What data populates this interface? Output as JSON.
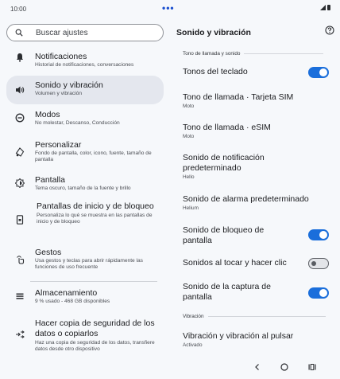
{
  "status": {
    "time": "10:00",
    "dots": "•••"
  },
  "search": {
    "placeholder": "Buscar ajustes"
  },
  "menu": [
    {
      "title": "Notificaciones",
      "sub": "Historial de notificaciones, conversaciones",
      "icon": "bell-icon"
    },
    {
      "title": "Sonido y vibración",
      "sub": "Volumen y vibración",
      "icon": "volume-icon"
    },
    {
      "title": "Modos",
      "sub": "No molestar, Descanso, Conducción",
      "icon": "do-not-disturb-icon"
    },
    {
      "title": "Personalizar",
      "sub": "Fondo de pantalla, color, icono, fuente, tamaño de pantalla",
      "icon": "palette-icon"
    },
    {
      "title": "Pantalla",
      "sub": "Tema oscuro, tamaño de la fuente y brillo",
      "icon": "display-brightness-icon"
    },
    {
      "title": "Pantallas de inicio y de bloqueo",
      "sub": "Personaliza lo qué se muestra en las pantallas de inicio y de bloqueo",
      "icon": "lock-screen-icon"
    },
    {
      "title": "Gestos",
      "sub": "Usa gestos y teclas para abrir rápidamente las funciones de uso frecuente",
      "icon": "gesture-icon"
    },
    {
      "title": "Almacenamiento",
      "sub": "9 % usado - 468 GB disponibles",
      "icon": "storage-icon"
    },
    {
      "title": "Hacer copia de seguridad de los datos o copiarlos",
      "sub": "Haz una copia de seguridad de los datos, transfiere datos desde otro dispositivo",
      "icon": "transfer-icon"
    }
  ],
  "detail": {
    "title": "Sonido y vibración",
    "section_ringtone": "Tono de llamada y sonido",
    "section_vibration": "Vibración",
    "settings": [
      {
        "title": "Tonos del teclado",
        "sub": "",
        "toggle": true
      },
      {
        "title": "Tono de llamada · Tarjeta SIM",
        "sub": "Moto"
      },
      {
        "title": "Tono de llamada · eSIM",
        "sub": "Moto"
      },
      {
        "title": "Sonido de notificación predeterminado",
        "sub": "Hello"
      },
      {
        "title": "Sonido de alarma predeterminado",
        "sub": "Helium"
      },
      {
        "title": "Sonido de bloqueo de pantalla",
        "sub": "",
        "toggle": true
      },
      {
        "title": "Sonidos al tocar y hacer clic",
        "sub": "",
        "toggle": false
      },
      {
        "title": "Sonido de la captura de pantalla",
        "sub": "",
        "toggle": true
      },
      {
        "title": "Vibración y vibración al pulsar",
        "sub": "Activado"
      }
    ]
  },
  "colors": {
    "accent": "#1a6edb",
    "selected_bg": "#e4e7ee",
    "background": "#f6f8fb"
  }
}
